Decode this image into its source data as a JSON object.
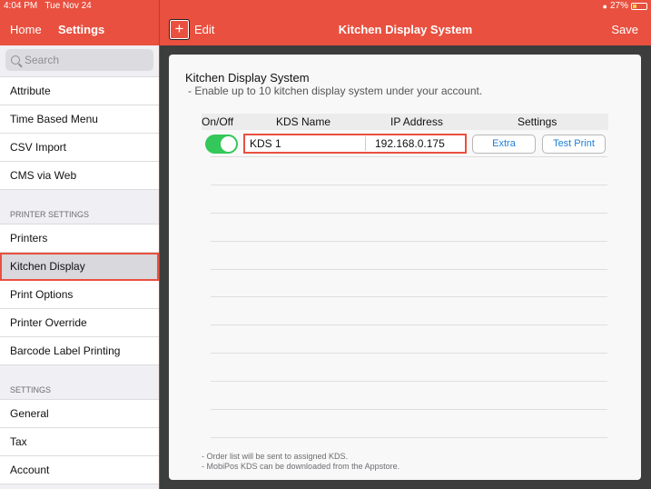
{
  "status": {
    "time": "4:04 PM",
    "date": "Tue Nov 24",
    "battery": "27%"
  },
  "nav": {
    "home_label": "Home",
    "settings_label": "Settings"
  },
  "header": {
    "edit_label": "Edit",
    "title": "Kitchen Display System",
    "save_label": "Save"
  },
  "search": {
    "placeholder": "Search"
  },
  "sidebar": {
    "group1": [
      "Attribute",
      "Time Based Menu",
      "CSV Import",
      "CMS via Web"
    ],
    "printer_section": "PRINTER SETTINGS",
    "group2": [
      "Printers",
      "Kitchen Display",
      "Print Options",
      "Printer Override",
      "Barcode Label Printing"
    ],
    "settings_section": "SETTINGS",
    "group3": [
      "General",
      "Tax",
      "Account"
    ]
  },
  "panel": {
    "title": "Kitchen Display System",
    "subtitle": "- Enable up to 10 kitchen display system under your account.",
    "columns": {
      "onoff": "On/Off",
      "name": "KDS Name",
      "ip": "IP Address",
      "settings": "Settings"
    },
    "row": {
      "name": "KDS 1",
      "ip": "192.168.0.175",
      "extra_label": "Extra",
      "test_label": "Test Print",
      "enabled": true
    },
    "notes": [
      "- Order list will be sent to assigned KDS.",
      "- MobiPos KDS can be downloaded from the Appstore."
    ]
  },
  "colors": {
    "accent": "#e9503f",
    "toggle_on": "#34c759",
    "link": "#1e7fd6"
  }
}
